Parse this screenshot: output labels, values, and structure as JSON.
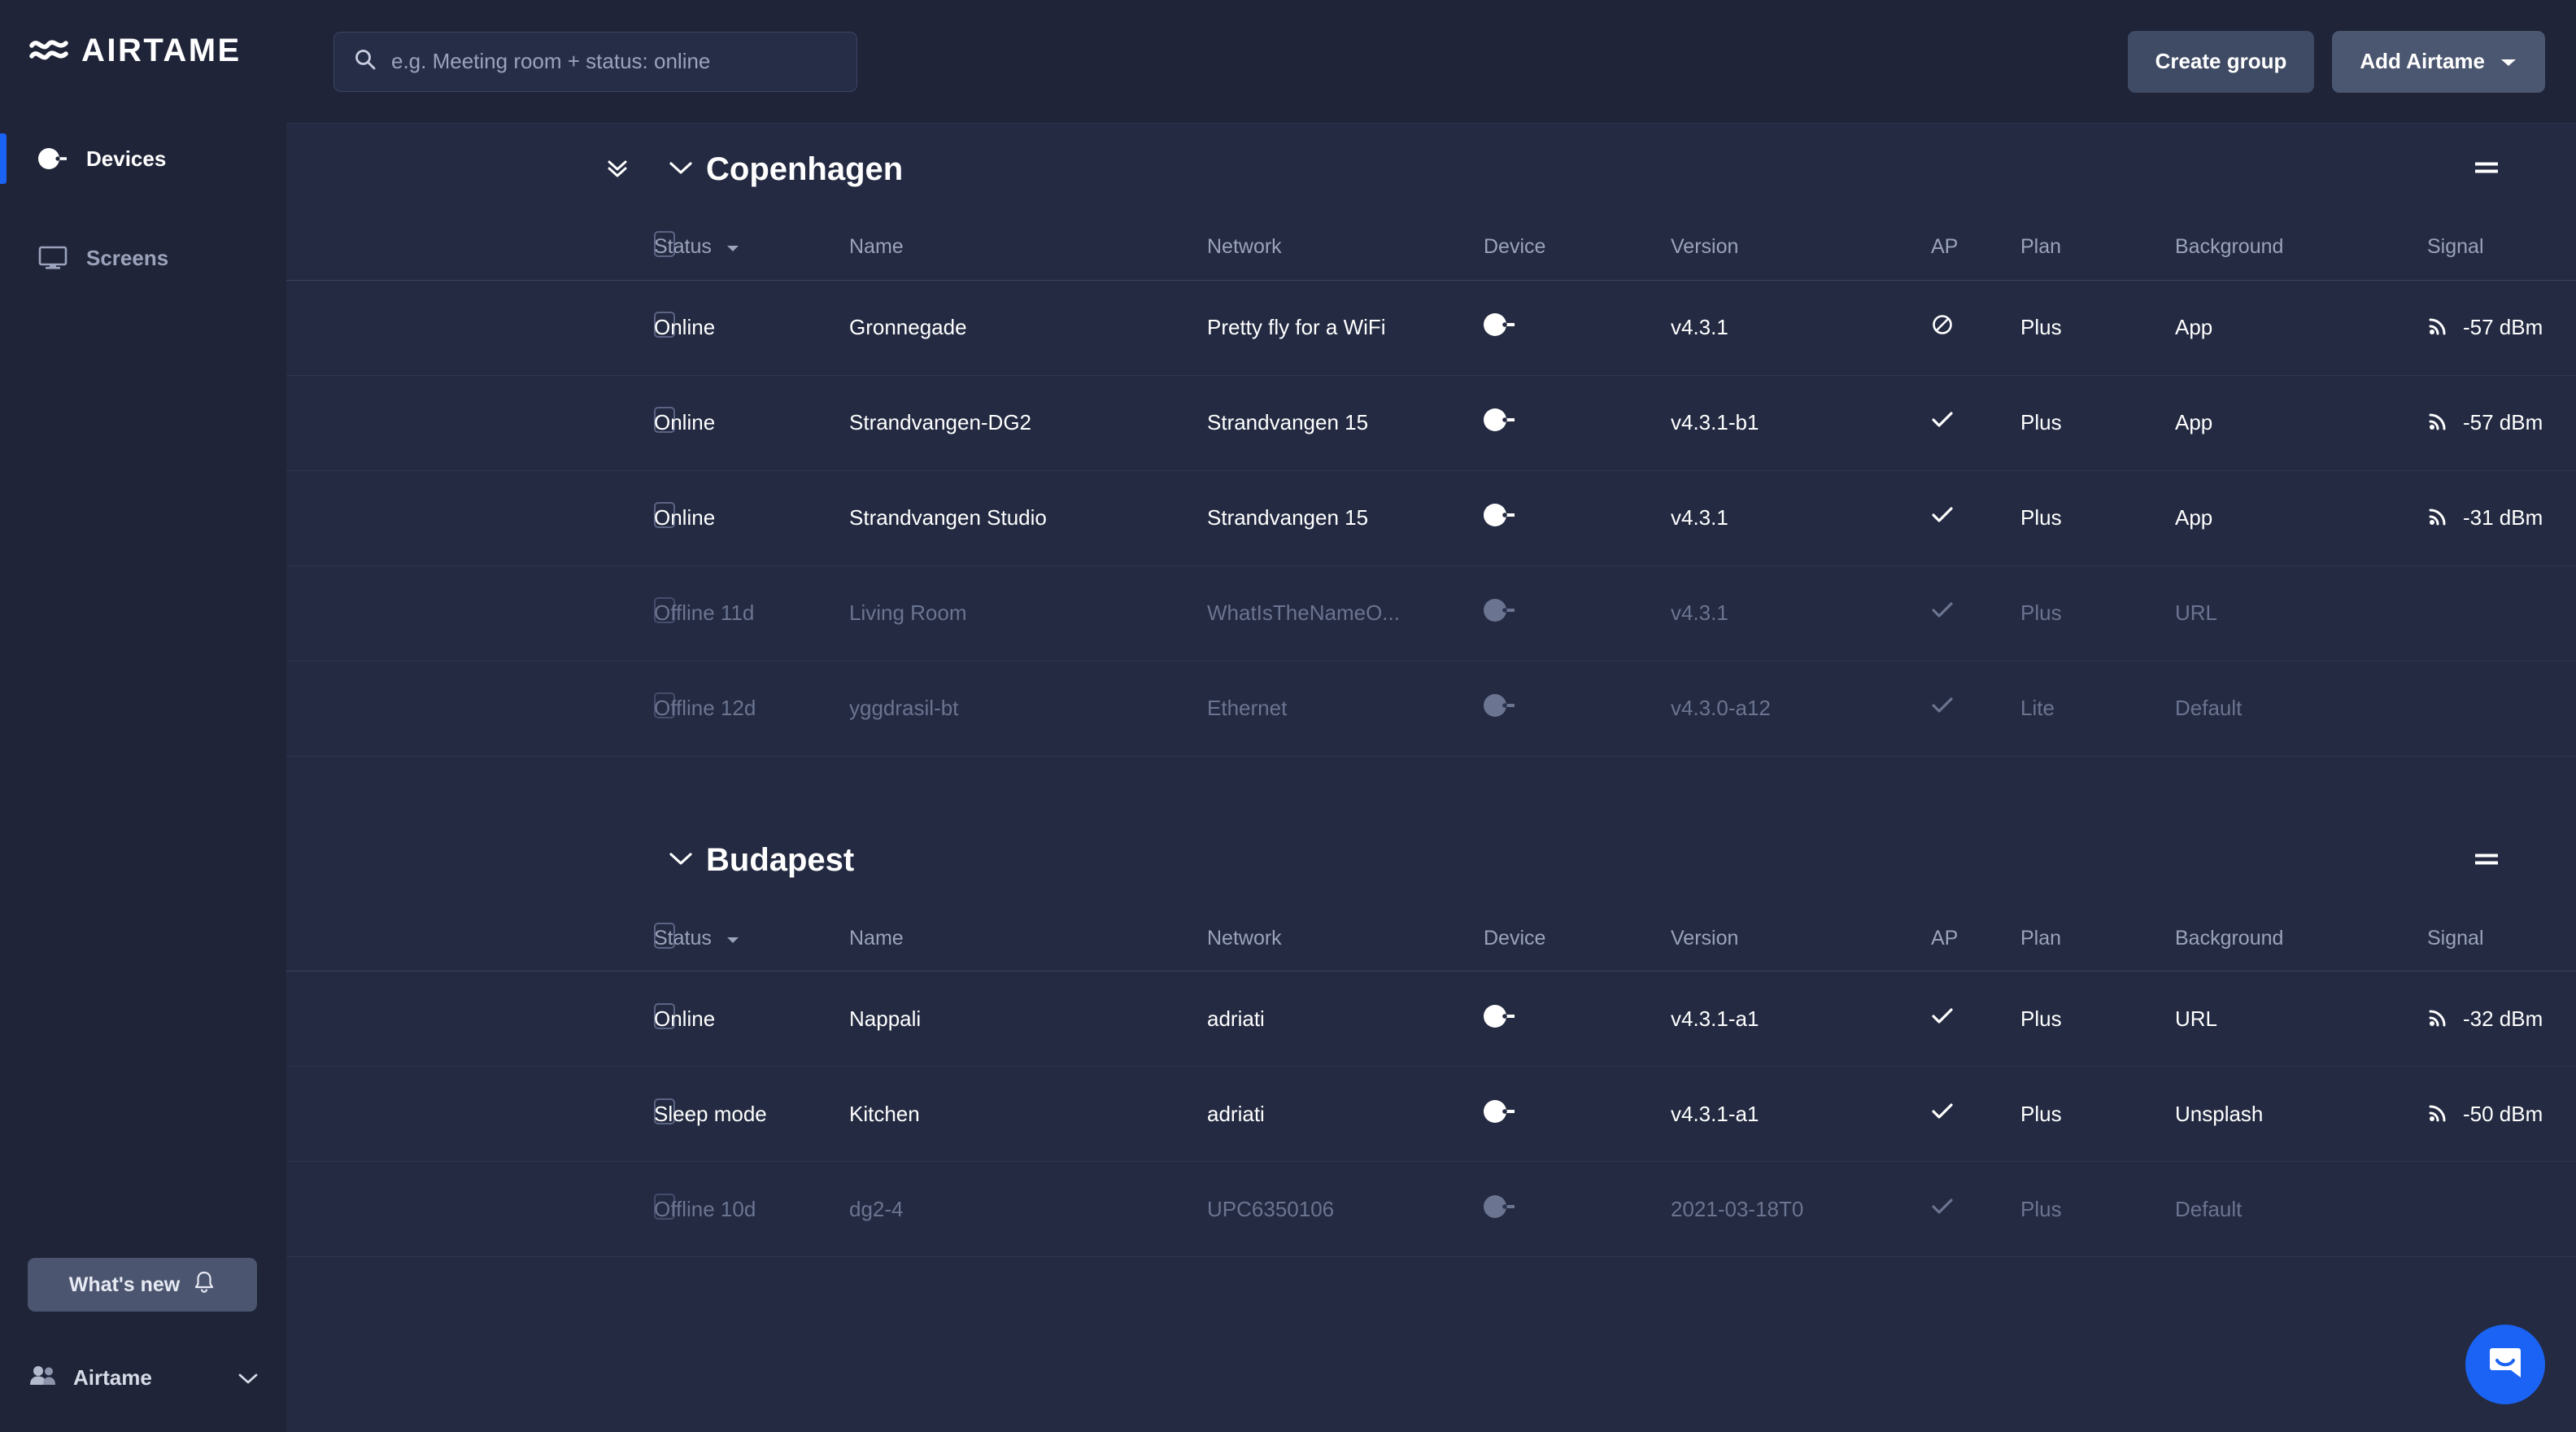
{
  "brand": {
    "name": "AIRTAME",
    "logo_icon": "airtame-waves-logo"
  },
  "sidebar": {
    "items": [
      {
        "label": "Devices",
        "icon": "dongle-icon",
        "active": true
      },
      {
        "label": "Screens",
        "icon": "monitor-icon",
        "active": false
      }
    ],
    "whats_new": {
      "label": "What's new",
      "icon": "bell-icon"
    },
    "org": {
      "label": "Airtame",
      "icon": "people-icon",
      "chevron": "chevron-down-icon"
    }
  },
  "topbar": {
    "search": {
      "placeholder": "e.g. Meeting room + status: online",
      "value": "",
      "icon": "search-icon"
    },
    "create_group_label": "Create group",
    "add_airtame_label": "Add Airtame",
    "add_airtame_caret": "▾"
  },
  "colors": {
    "accent": "#1a63f4",
    "sidebar_bg": "#1f2438",
    "main_bg": "#232a41",
    "muted_text": "#9aa3bb",
    "dim_text": "#6b7490"
  },
  "columns": [
    "Status",
    "Name",
    "Network",
    "Device",
    "Version",
    "AP",
    "Plan",
    "Background",
    "Signal"
  ],
  "groups": [
    {
      "name": "Copenhagen",
      "collapse_all_icon": "double-chevron-down-icon",
      "chevron_icon": "chevron-down-icon",
      "menu_icon": "group-menu-icon",
      "rows": [
        {
          "status": "Online",
          "name": "Gronnegade",
          "network": "Pretty fly for a WiFi",
          "device": "dongle-icon",
          "version": "v4.3.1",
          "ap": "blocked",
          "plan": "Plus",
          "background": "App",
          "signal": "-57 dBm",
          "offline": false
        },
        {
          "status": "Online",
          "name": "Strandvangen-DG2",
          "network": "Strandvangen 15",
          "device": "dongle-icon",
          "version": "v4.3.1-b1",
          "ap": "check",
          "plan": "Plus",
          "background": "App",
          "signal": "-57 dBm",
          "offline": false
        },
        {
          "status": "Online",
          "name": "Strandvangen Studio",
          "network": "Strandvangen 15",
          "device": "dongle-icon",
          "version": "v4.3.1",
          "ap": "check",
          "plan": "Plus",
          "background": "App",
          "signal": "-31 dBm",
          "offline": false
        },
        {
          "status": "Offline 11d",
          "name": "Living Room",
          "network": "WhatIsTheNameO...",
          "device": "dongle-icon",
          "version": "v4.3.1",
          "ap": "check",
          "plan": "Plus",
          "background": "URL",
          "signal": "",
          "offline": true
        },
        {
          "status": "Offline 12d",
          "name": "yggdrasil-bt",
          "network": "Ethernet",
          "device": "dongle-icon",
          "version": "v4.3.0-a12",
          "ap": "check",
          "plan": "Lite",
          "background": "Default",
          "signal": "",
          "offline": true
        }
      ]
    },
    {
      "name": "Budapest",
      "collapse_all_icon": "",
      "chevron_icon": "chevron-down-icon",
      "menu_icon": "group-menu-icon",
      "rows": [
        {
          "status": "Online",
          "name": "Nappali",
          "network": "adriati",
          "device": "dongle-icon",
          "version": "v4.3.1-a1",
          "ap": "check",
          "plan": "Plus",
          "background": "URL",
          "signal": "-32 dBm",
          "offline": false
        },
        {
          "status": "Sleep mode",
          "name": "Kitchen",
          "network": "adriati",
          "device": "dongle-icon",
          "version": "v4.3.1-a1",
          "ap": "check",
          "plan": "Plus",
          "background": "Unsplash",
          "signal": "-50 dBm",
          "offline": false
        },
        {
          "status": "Offline 10d",
          "name": "dg2-4",
          "network": "UPC6350106",
          "device": "dongle-icon",
          "version": "2021-03-18T0",
          "ap": "check",
          "plan": "Plus",
          "background": "Default",
          "signal": "",
          "offline": true
        }
      ]
    }
  ],
  "intercom": {
    "icon": "intercom-chat-icon"
  }
}
